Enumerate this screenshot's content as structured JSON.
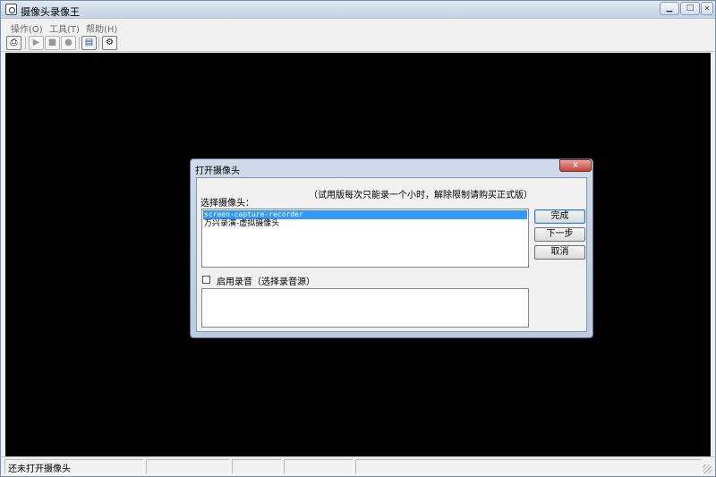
{
  "window": {
    "title": "摄像头录像王",
    "controls": {
      "minimize": "▁",
      "maximize": "□",
      "close": "✕"
    }
  },
  "menu": [
    {
      "label": "操作(O)"
    },
    {
      "label": "工具(T)"
    },
    {
      "label": "帮助(H)"
    }
  ],
  "toolbar": {
    "icons": [
      "open-camera-icon",
      "play-icon",
      "stop-icon",
      "record-icon",
      "book-icon",
      "settings-gear-icon"
    ],
    "glyphs": {
      "open_camera": "⎙",
      "play": "▶",
      "stop": "■",
      "record": "●",
      "book": "▤",
      "settings": "⚙"
    }
  },
  "status": {
    "text": "还未打开摄像头"
  },
  "dialog": {
    "title": "打开摄像头",
    "close_glyph": "x",
    "notice": "（试用版每次只能录一个小时，解除限制请购买正式版）",
    "camera_label": "选择摄像头：",
    "cameras": [
      {
        "label": "screen-capture-recorder",
        "selected": true
      },
      {
        "label": "万兴录演-虚拟摄像头",
        "selected": false
      }
    ],
    "buttons": {
      "finish": "完成",
      "next": "下一步",
      "cancel": "取消"
    },
    "audio_checkbox_label": "启用录音（选择录音源）",
    "audio_checkbox_checked": false
  },
  "colors": {
    "selection": "#3399ff",
    "viewport": "#000000"
  }
}
